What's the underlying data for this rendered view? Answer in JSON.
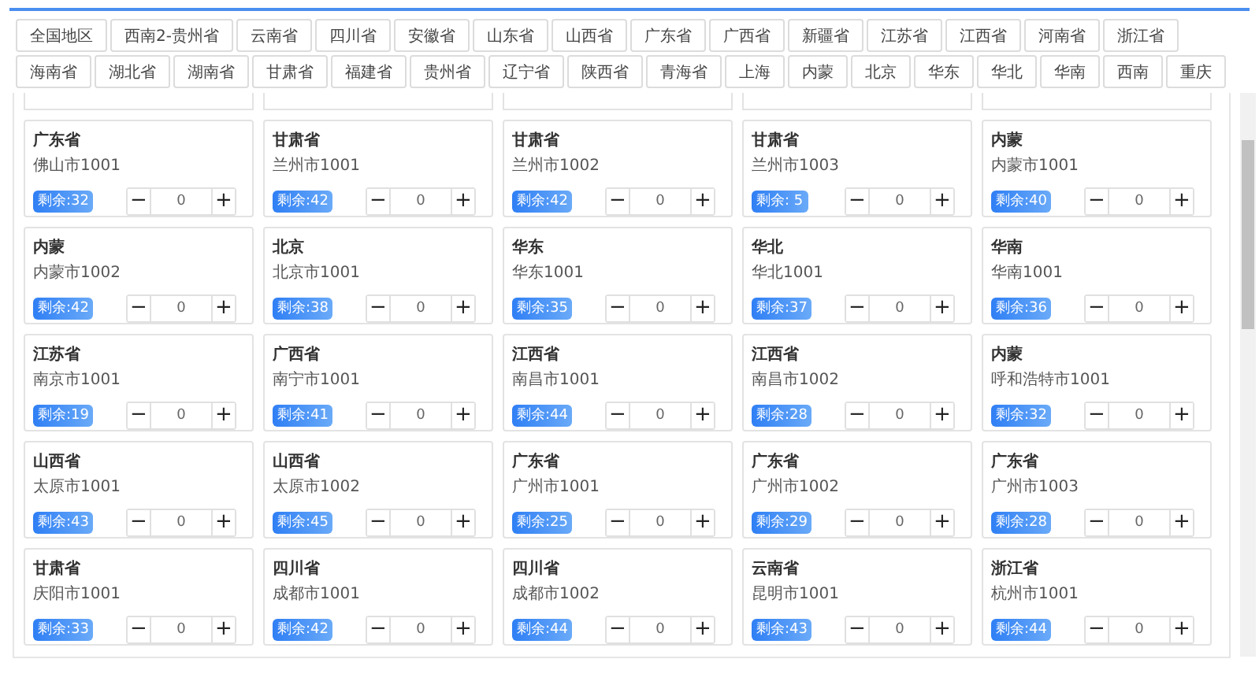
{
  "region_tabs": [
    "全国地区",
    "西南2-贵州省",
    "云南省",
    "四川省",
    "安徽省",
    "山东省",
    "山西省",
    "广东省",
    "广西省",
    "新疆省",
    "江苏省",
    "江西省",
    "河南省",
    "浙江省",
    "海南省",
    "湖北省",
    "湖南省",
    "甘肃省",
    "福建省",
    "贵州省",
    "辽宁省",
    "陕西省",
    "青海省",
    "上海",
    "内蒙",
    "北京",
    "华东",
    "华北",
    "华南",
    "西南",
    "重庆"
  ],
  "cards": [
    {
      "province": "广东省",
      "city": "佛山市1001",
      "remaining": "剩余:32",
      "quantity": "0"
    },
    {
      "province": "甘肃省",
      "city": "兰州市1001",
      "remaining": "剩余:42",
      "quantity": "0"
    },
    {
      "province": "甘肃省",
      "city": "兰州市1002",
      "remaining": "剩余:42",
      "quantity": "0"
    },
    {
      "province": "甘肃省",
      "city": "兰州市1003",
      "remaining": "剩余: 5",
      "quantity": "0"
    },
    {
      "province": "内蒙",
      "city": "内蒙市1001",
      "remaining": "剩余:40",
      "quantity": "0"
    },
    {
      "province": "内蒙",
      "city": "内蒙市1002",
      "remaining": "剩余:42",
      "quantity": "0"
    },
    {
      "province": "北京",
      "city": "北京市1001",
      "remaining": "剩余:38",
      "quantity": "0"
    },
    {
      "province": "华东",
      "city": "华东1001",
      "remaining": "剩余:35",
      "quantity": "0"
    },
    {
      "province": "华北",
      "city": "华北1001",
      "remaining": "剩余:37",
      "quantity": "0"
    },
    {
      "province": "华南",
      "city": "华南1001",
      "remaining": "剩余:36",
      "quantity": "0"
    },
    {
      "province": "江苏省",
      "city": "南京市1001",
      "remaining": "剩余:19",
      "quantity": "0"
    },
    {
      "province": "广西省",
      "city": "南宁市1001",
      "remaining": "剩余:41",
      "quantity": "0"
    },
    {
      "province": "江西省",
      "city": "南昌市1001",
      "remaining": "剩余:44",
      "quantity": "0"
    },
    {
      "province": "江西省",
      "city": "南昌市1002",
      "remaining": "剩余:28",
      "quantity": "0"
    },
    {
      "province": "内蒙",
      "city": "呼和浩特市1001",
      "remaining": "剩余:32",
      "quantity": "0"
    },
    {
      "province": "山西省",
      "city": "太原市1001",
      "remaining": "剩余:43",
      "quantity": "0"
    },
    {
      "province": "山西省",
      "city": "太原市1002",
      "remaining": "剩余:45",
      "quantity": "0"
    },
    {
      "province": "广东省",
      "city": "广州市1001",
      "remaining": "剩余:25",
      "quantity": "0"
    },
    {
      "province": "广东省",
      "city": "广州市1002",
      "remaining": "剩余:29",
      "quantity": "0"
    },
    {
      "province": "广东省",
      "city": "广州市1003",
      "remaining": "剩余:28",
      "quantity": "0"
    },
    {
      "province": "甘肃省",
      "city": "庆阳市1001",
      "remaining": "剩余:33",
      "quantity": "0"
    },
    {
      "province": "四川省",
      "city": "成都市1001",
      "remaining": "剩余:42",
      "quantity": "0"
    },
    {
      "province": "四川省",
      "city": "成都市1002",
      "remaining": "剩余:44",
      "quantity": "0"
    },
    {
      "province": "云南省",
      "city": "昆明市1001",
      "remaining": "剩余:43",
      "quantity": "0"
    },
    {
      "province": "浙江省",
      "city": "杭州市1001",
      "remaining": "剩余:44",
      "quantity": "0"
    }
  ],
  "stepper_signs": {
    "minus": "−",
    "plus": "+"
  }
}
